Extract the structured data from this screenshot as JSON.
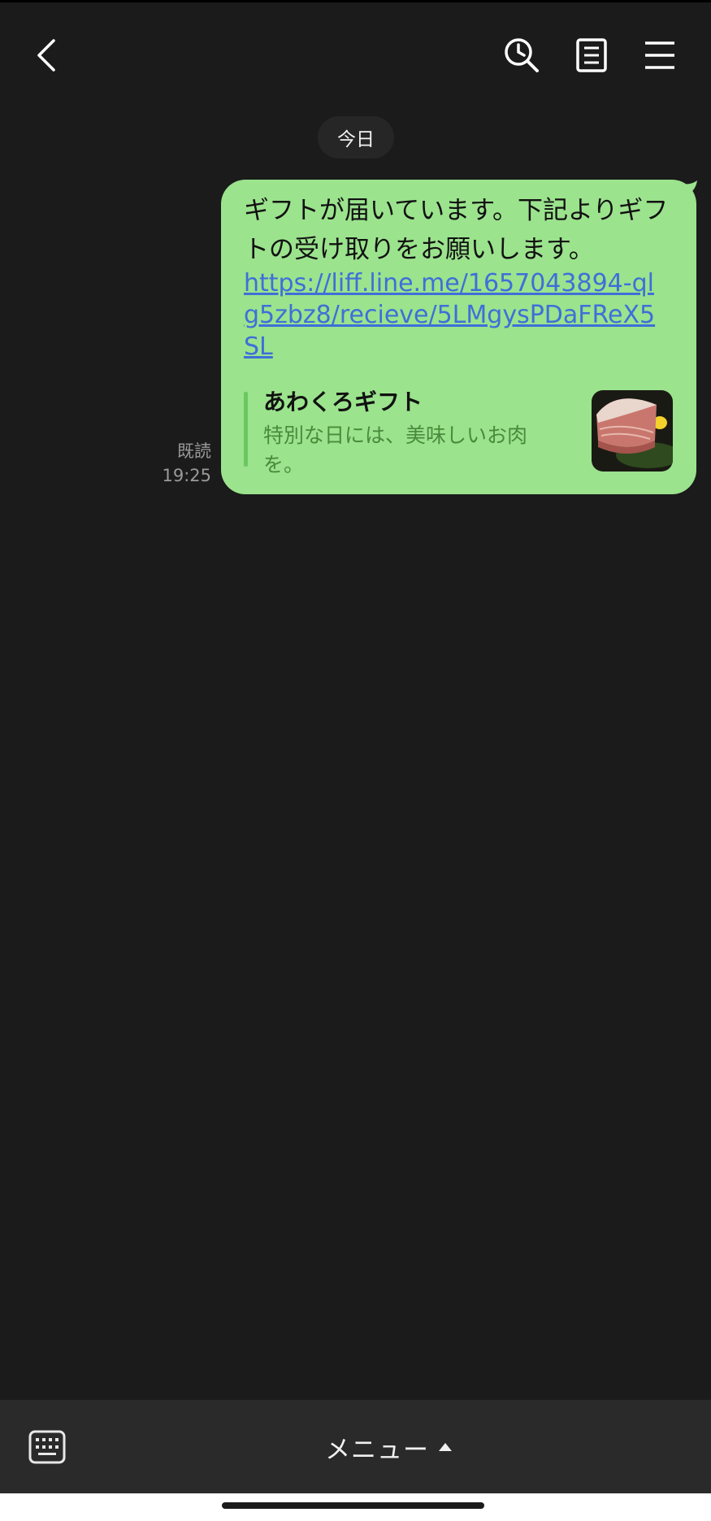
{
  "header": {
    "icons": [
      "back-chevron-icon",
      "history-search-icon",
      "notes-icon",
      "hamburger-menu-icon"
    ]
  },
  "chat": {
    "date_label": "今日",
    "read_label": "既読",
    "time": "19:25",
    "message": {
      "text": "ギフトが届いています。下記よりギフトの受け取りをお願いします。",
      "link": "https://liff.line.me/1657043894-qlg5zbz8/recieve/5LMgysPDaFReX5SL",
      "preview": {
        "title": "あわくろギフト",
        "description": "特別な日には、美味しいお肉を。",
        "thumbnail_icon": "meat-photo-thumbnail"
      }
    }
  },
  "bottom_bar": {
    "keyboard_icon": "keyboard-icon",
    "menu_label": "メニュー"
  },
  "colors": {
    "background": "#1b1b1b",
    "bubble": "#9be38d",
    "link": "#3e6fd9",
    "preview_accent": "#6cc85e"
  }
}
